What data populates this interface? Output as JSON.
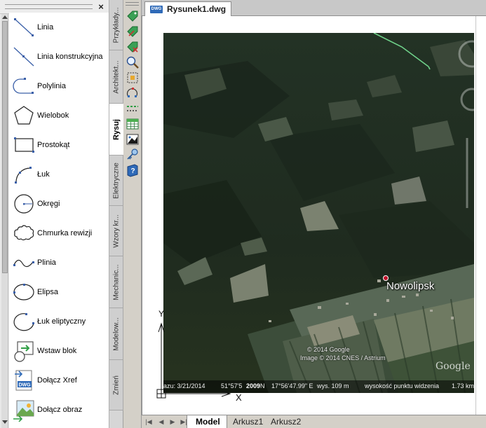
{
  "palette": {
    "close_glyph": "×",
    "tools": [
      {
        "label": "Linia",
        "icon": "line-icon"
      },
      {
        "label": "Linia konstrukcyjna",
        "icon": "construction-line-icon"
      },
      {
        "label": "Polylinia",
        "icon": "polyline-icon"
      },
      {
        "label": "Wielobok",
        "icon": "polygon-icon"
      },
      {
        "label": "Prostokąt",
        "icon": "rectangle-icon"
      },
      {
        "label": "Łuk",
        "icon": "arc-icon"
      },
      {
        "label": "Okręgi",
        "icon": "circle-icon"
      },
      {
        "label": "Chmurka rewizji",
        "icon": "revision-cloud-icon"
      },
      {
        "label": "Plinia",
        "icon": "spline-icon"
      },
      {
        "label": "Elipsa",
        "icon": "ellipse-icon"
      },
      {
        "label": "Łuk eliptyczny",
        "icon": "elliptical-arc-icon"
      },
      {
        "label": "Wstaw blok",
        "icon": "insert-block-icon"
      },
      {
        "label": "Dołącz Xref",
        "icon": "attach-xref-icon"
      },
      {
        "label": "Dołącz obraz",
        "icon": "attach-image-icon"
      }
    ],
    "tabs": [
      {
        "label": "Przykłady..."
      },
      {
        "label": "Architekt..."
      },
      {
        "label": "Rysuj",
        "active": true
      },
      {
        "label": "Elektryczne"
      },
      {
        "label": "Wzory kr..."
      },
      {
        "label": "Mechanic..."
      },
      {
        "label": "Modelow..."
      },
      {
        "label": "Zmień"
      }
    ]
  },
  "toolbar": {
    "buttons": [
      "tag-green-icon",
      "tag-arrow-icon",
      "tag-x-icon",
      "zoom-icon",
      "select-window-icon",
      "rotate-nodes-icon",
      "dashed-line-icon",
      "table-icon",
      "image-icon",
      "key-icon",
      "help-book-icon"
    ]
  },
  "document": {
    "tab_badge": "DWG",
    "tab_name": "Rysunek1.dwg"
  },
  "map": {
    "place_label": "Nowolipsk",
    "copyright_1": "© 2014 Google",
    "copyright_2": "Image © 2014 CNES / Astrium",
    "logo": "Google",
    "status_date": "azu: 3/21/2014",
    "status_lat": "51°57'5",
    "status_year": "2009",
    "status_lat_dir": "N",
    "status_lon": "17°56'47.99\" E",
    "status_elev": "wys.  109 m",
    "status_eye": "wysokość punktu widzenia",
    "status_eye_val": "1.73 km"
  },
  "ucs": {
    "y_label": "Y",
    "x_label": "X"
  },
  "layout": {
    "nav": [
      "|◀",
      "◀",
      "▶",
      "▶|"
    ],
    "tabs": [
      {
        "label": "Model",
        "active": true
      },
      {
        "label": "Arkusz1"
      },
      {
        "label": "Arkusz2"
      }
    ]
  }
}
